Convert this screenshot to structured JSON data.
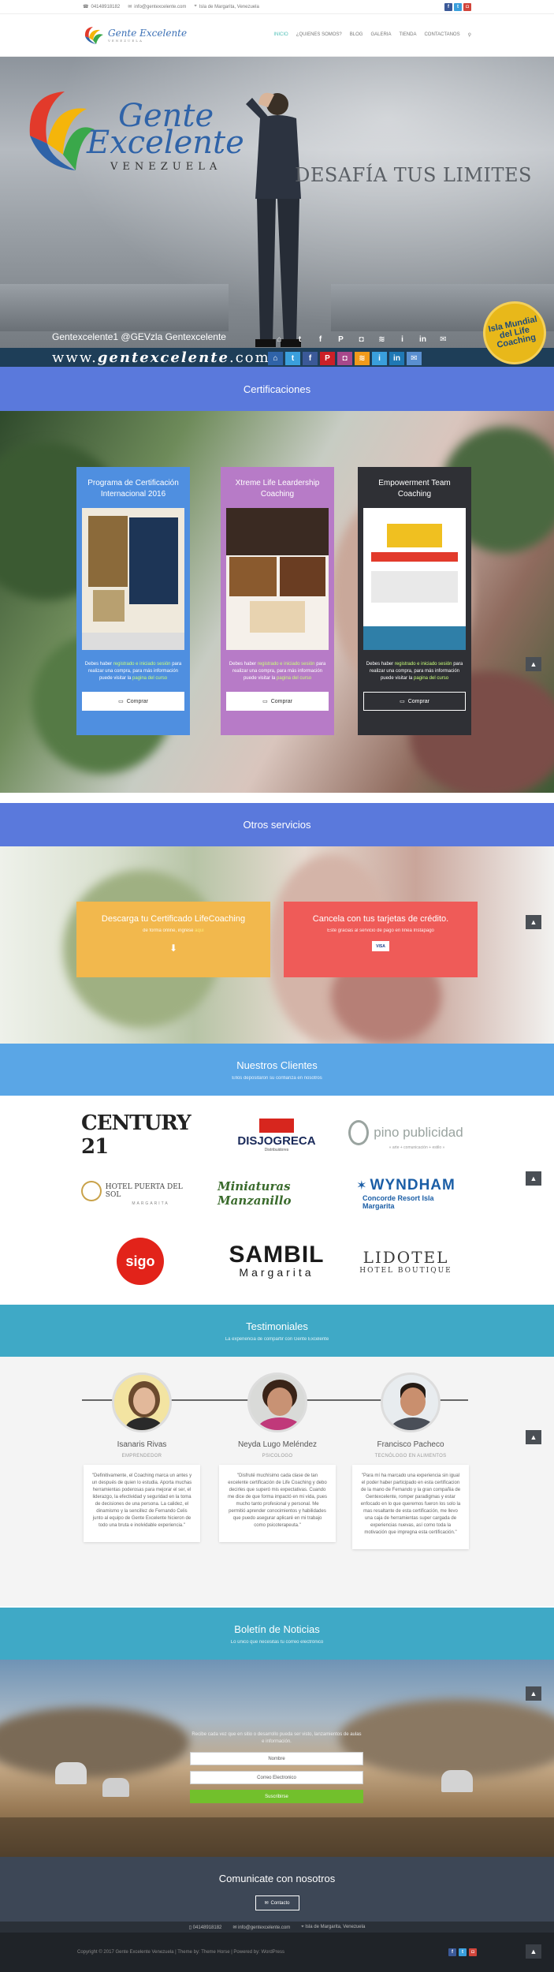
{
  "topbar": {
    "phone": "04148918182",
    "email": "info@gentexcelente.com",
    "location": "Isla de Margarita, Venezuela"
  },
  "header": {
    "logo_text": "Gente Excelente",
    "logo_sub": "VENEZUELA",
    "nav": [
      "INICIO",
      "¿QUIENES SOMOS?",
      "BLOG",
      "GALERIA",
      "TIENDA",
      "CONTACTANOS"
    ]
  },
  "hero": {
    "logo_line1": "Gente",
    "logo_line2": "Excelente",
    "logo_sub": "VENEZUELA",
    "title": "DESAFÍA TUS LIMITES",
    "handles": "Gentexcelente1   @GEVzla   Gentexcelente",
    "url_pre": "www.",
    "url_bold": "gentexcelente",
    "url_post": ".com",
    "badge": "Isla Mundial del Life Coaching"
  },
  "certificaciones": {
    "heading": "Certificaciones",
    "cards": [
      {
        "title": "Programa de Certificación Internacional 2016",
        "desc_pre": "Debes haber ",
        "desc_link": "registrado e iniciado sesión",
        "desc_mid": " para realizar una compra, para más información puede visitar la ",
        "desc_link2": "pagina del curso",
        "button": "Comprar",
        "color": "#4f8fe0"
      },
      {
        "title": "Xtreme Life Leardership Coaching",
        "desc_pre": "Debes haber ",
        "desc_link": "registrado e iniciado sesión",
        "desc_mid": " para realizar una compra, para más información puede visitar la ",
        "desc_link2": "pagina del curso",
        "button": "Comprar",
        "color": "#b77bc7"
      },
      {
        "title": "Empowerment Team Coaching",
        "desc_pre": "Debes haber ",
        "desc_link": "registrado e iniciado sesión",
        "desc_mid": " para realizar una compra, para más información puede visitar la ",
        "desc_link2": "pagina del curso",
        "button": "Comprar",
        "color": "#2f3035"
      }
    ]
  },
  "otros": {
    "heading": "Otros servicios",
    "services": [
      {
        "title": "Descarga tu Certificado LifeCoaching",
        "desc_pre": "de forma online, ingrese ",
        "desc_link": "aquí",
        "color": "#f2b84d"
      },
      {
        "title": "Cancela con tus tarjetas de crédito.",
        "desc_pre": "Este gracias al servicio de pago en línea Instapago",
        "desc_link": "",
        "color": "#ef5b58"
      }
    ]
  },
  "clientes": {
    "heading": "Nuestros Clientes",
    "subheading": "Ellos depositaron su confianza en nosotros",
    "logos": [
      {
        "name": "CENTURY 21",
        "sub": ""
      },
      {
        "name": "DISJOGRECA",
        "sub": "Distribuidores"
      },
      {
        "name": "pino publicidad",
        "sub": "« arte + comunicación + estilo »"
      },
      {
        "name": "HOTEL PUERTA DEL SOL",
        "sub": "MARGARITA"
      },
      {
        "name": "Miniaturas Manzanillo",
        "sub": ""
      },
      {
        "name": "WYNDHAM",
        "sub": "Concorde Resort Isla Margarita"
      },
      {
        "name": "sigo",
        "sub": ""
      },
      {
        "name": "SAMBIL",
        "sub": "Margarita"
      },
      {
        "name": "LIDOTEL",
        "sub": "HOTEL BOUTIQUE"
      }
    ]
  },
  "testimonios": {
    "heading": "Testimoniales",
    "subheading": "La experiencia de compartir con Gente Excelente",
    "items": [
      {
        "name": "Isanaris Rivas",
        "role": "EMPRENDEDOR",
        "text": "\"Definitivamente, el Coaching marca un antes y un después de quien lo estudia. Aporta muchas herramientas poderosas para mejorar el ser, el liderazgo, la efectividad y seguridad en la toma de decisiones de una persona. La calidez, el dinamismo y la sencillez de Fernando Celis junto al equipo de Gente Excelente hicieron de todo una bruta e inolvidable experiencia.\""
      },
      {
        "name": "Neyda Lugo Meléndez",
        "role": "PSICOLOGO",
        "text": "\"Disfruté muchísimo cada clase de tan excelente certificación de Life Coaching y debo decirles que superó mis expectativas. Cuando me dice de que forma impactó en mi vida, pues mucho tanto profesional y personal. Me permitió aprender conocimientos y habilidades que puedo asegurar aplicaré en mi trabajo como psicoterapeuta.\""
      },
      {
        "name": "Francisco Pacheco",
        "role": "TECNÓLOGO EN ALIMENTOS",
        "text": "\"Para mí ha marcado una experiencia sin igual el poder haber participado en esta certificacion de la mano de Fernando y la gran compañia de Gentexcelente, romper paradigmas y estar enfocado en lo que queremos fueron los solo la mas resaltante de esta certificación, me llevo una caja de herramientas super cargada de experiencias nuevas, así como toda la motivación que impregna esta certificación.\""
      }
    ]
  },
  "boletin": {
    "heading": "Boletín de Noticias",
    "subheading": "Lo único que necesitas tu correo electrónico",
    "intro": "Recibe cada vez que en sitio o desarrollo pueda ser visto, lanzamientos de aulas e información.",
    "name_placeholder": "Nombre",
    "email_placeholder": "Correo Electronico",
    "submit": "Suscribirse"
  },
  "contacto": {
    "heading": "Comunicate con nosotros",
    "button": "Contacto"
  },
  "infobar": {
    "phone": "04148918182",
    "email": "info@gentexcelente.com",
    "location": "Isla de Margarita, Venezuela"
  },
  "footer": {
    "copyright": "Copyright © 2017 Gente Excelente Venezuela | Theme by: Theme Horse | Powered by: WordPress"
  },
  "colors": {
    "blue_header": "#5a79dc",
    "clients_header": "#5aa6e6",
    "testi_header": "#3fa9c6",
    "news_header": "#3fa9c6",
    "accent_green": "#72c02c"
  }
}
